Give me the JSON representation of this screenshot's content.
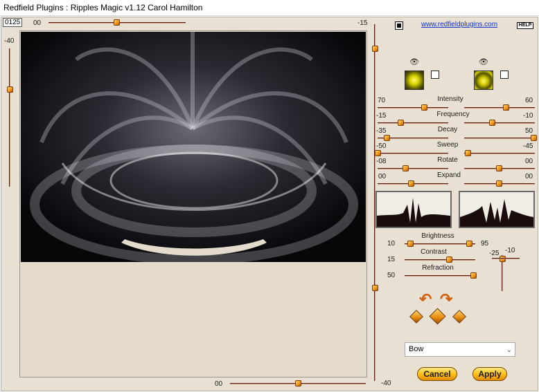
{
  "window": {
    "title": "Redfield Plugins : Ripples Magic v1.12   Carol Hamilton"
  },
  "top": {
    "counter": "0125",
    "top_slider_value": "00",
    "right_slider_value": "-15",
    "left_slider_value": "-40",
    "bottom_slider_value": "00",
    "right_vertical_value": "-40",
    "website": "www.redfieldplugins.com",
    "help_label": "HELP"
  },
  "params": {
    "rows": [
      {
        "label": "Intensity",
        "left": "70",
        "right": "60"
      },
      {
        "label": "Frequency",
        "left": "-15",
        "right": "-10"
      },
      {
        "label": "Decay",
        "left": "-35",
        "right": "50"
      },
      {
        "label": "Sweep",
        "left": "-50",
        "right": "-45"
      },
      {
        "label": "Rotate",
        "left": "-08",
        "right": "00"
      },
      {
        "label": "Expand",
        "left": "00",
        "right": "00"
      }
    ]
  },
  "lighting": {
    "brightness_label": "Brightness",
    "brightness_left": "10",
    "brightness_right": "95",
    "contrast_label": "Contrast",
    "contrast_value": "15",
    "refraction_label": "Refraction",
    "refraction_value": "50",
    "light_vertical_left": "-25",
    "light_vertical_right": "-10"
  },
  "bottom": {
    "preset_selected": "Bow",
    "cancel_label": "Cancel",
    "apply_label": "Apply"
  },
  "icons": {
    "eye": "eye-icon",
    "random": "dice-icon",
    "undo": "undo-arrow-icon",
    "redo": "redo-arrow-icon"
  }
}
